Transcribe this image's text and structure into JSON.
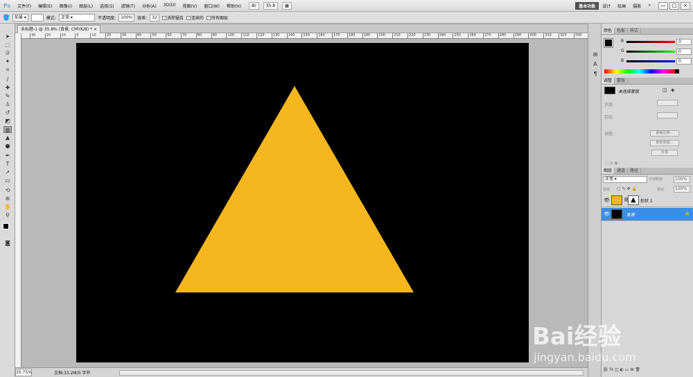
{
  "app": {
    "logo": "Ps"
  },
  "menu": [
    "文件(F)",
    "编辑(E)",
    "图像(I)",
    "图层(L)",
    "选择(S)",
    "滤镜(T)",
    "分析(A)",
    "3D(D)",
    "视图(V)",
    "窗口(W)",
    "帮助(H)"
  ],
  "menubar_zoom": "35.8",
  "workspaces": [
    {
      "label": "基本功能",
      "active": true
    },
    {
      "label": "设计",
      "active": false
    },
    {
      "label": "绘画",
      "active": false
    },
    {
      "label": "摄影",
      "active": false
    },
    {
      "label": "»",
      "active": false
    }
  ],
  "window_controls": [
    "—",
    "□",
    "×"
  ],
  "options": {
    "fill_label": "前景",
    "mode_label": "模式:",
    "mode_value": "正常",
    "opacity_label": "不透明度:",
    "opacity_value": "100%",
    "tolerance_label": "容差:",
    "tolerance_value": "32",
    "antialias_label": "消除锯齿",
    "contiguous_label": "连续的",
    "all_layers_label": "所有图层"
  },
  "document": {
    "tab_title": "未标题-1 @ 35.8% (背景, CMYK/8) *",
    "ruler_ticks": [
      "30",
      "20",
      "10",
      "0",
      "10",
      "20",
      "30",
      "40",
      "50",
      "60",
      "70",
      "80",
      "90",
      "100",
      "110",
      "120",
      "130",
      "140",
      "150",
      "160",
      "170",
      "180",
      "190",
      "200",
      "210",
      "220",
      "230",
      "240",
      "250",
      "260",
      "270",
      "280",
      "290",
      "300",
      "310",
      "320",
      "330"
    ],
    "zoom": "35.75%",
    "info": "文档:33.2M/0 字节"
  },
  "colors": {
    "canvas_bg": "#000000",
    "shape_fill": "#f5b61e",
    "selected_layer": "#3a8ee6"
  },
  "color_panel": {
    "tabs": [
      "颜色",
      "色板",
      "样式"
    ],
    "channels": [
      {
        "label": "R",
        "value": "0"
      },
      {
        "label": "G",
        "value": "0"
      },
      {
        "label": "B",
        "value": "0"
      }
    ]
  },
  "mask_panel": {
    "tabs": [
      "调整",
      "蒙版"
    ],
    "title": "未选择蒙版",
    "density_label": "浓度:",
    "feather_label": "羽化:",
    "refine_label": "调整:",
    "buttons": [
      "蒙版边缘...",
      "颜色范围...",
      "反相"
    ]
  },
  "layers_panel": {
    "tabs": [
      "图层",
      "通道",
      "路径"
    ],
    "blend_mode": "正常",
    "opacity_label": "不透明度:",
    "opacity_value": "100%",
    "lock_label": "锁定:",
    "fill_label": "填充:",
    "fill_value": "100%",
    "layers": [
      {
        "name": "形状 1",
        "selected": false,
        "thumb_color": "#f5b61e"
      },
      {
        "name": "背景",
        "selected": true,
        "thumb_color": "#000000"
      }
    ]
  },
  "watermark": {
    "logo_text": "Bai经验",
    "url": "jingyan.baidu.com"
  }
}
